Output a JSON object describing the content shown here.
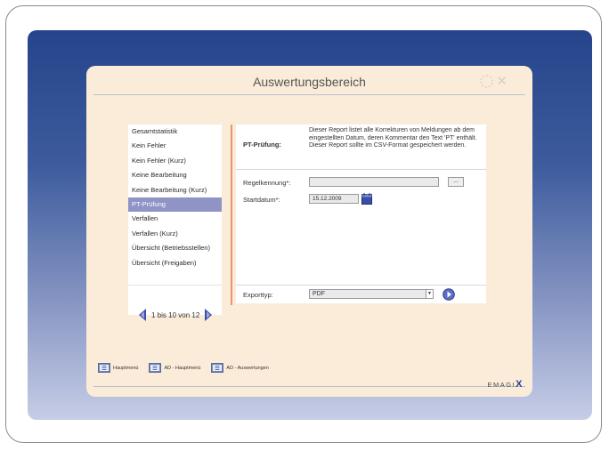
{
  "panel": {
    "title": "Auswertungsbereich"
  },
  "nav": {
    "items": [
      "Gesamtstatistik",
      "Kein Fehler",
      "Kein Fehler (Kurz)",
      "Keine Bearbeitung",
      "Keine Bearbeitung (Kurz)",
      "PT-Prüfung",
      "Verfallen",
      "Verfallen (Kurz)",
      "Übersicht (Betriebsstellen)",
      "Übersicht (Freigaben)"
    ],
    "selected_index": 5
  },
  "pager": {
    "text": "1 bis 10 von 12"
  },
  "report": {
    "name": "PT-Prüfung:",
    "description": "Dieser Report listet alle Korrekturen von Meldungen ab dem eingestellten Datum, deren Kommentar den Text 'PT' enthält. Dieser Report sollte im CSV-Format gespeichert werden."
  },
  "form": {
    "regelkennung_label": "Regelkennung*:",
    "regelkennung_value": "",
    "browse_label": "...",
    "startdatum_label": "Startdatum*:",
    "startdatum_value": "15.12.2009",
    "exporttyp_label": "Exporttyp:",
    "exporttyp_value": "PDF"
  },
  "footer": {
    "buttons": [
      "Hauptmenü",
      "AD - Hauptmenü",
      "AD - Auswertungen"
    ],
    "brand": "EMAGIX"
  },
  "colors": {
    "panel_bg": "#faecd9",
    "selected_bg": "#8f93c6",
    "divider": "#e89572",
    "accent_blue": "#3b4fa8"
  },
  "icons": [
    "spinner-icon",
    "close-icon",
    "arrow-left-icon",
    "arrow-right-icon",
    "calendar-icon",
    "go-arrow-icon",
    "menu-icon"
  ]
}
